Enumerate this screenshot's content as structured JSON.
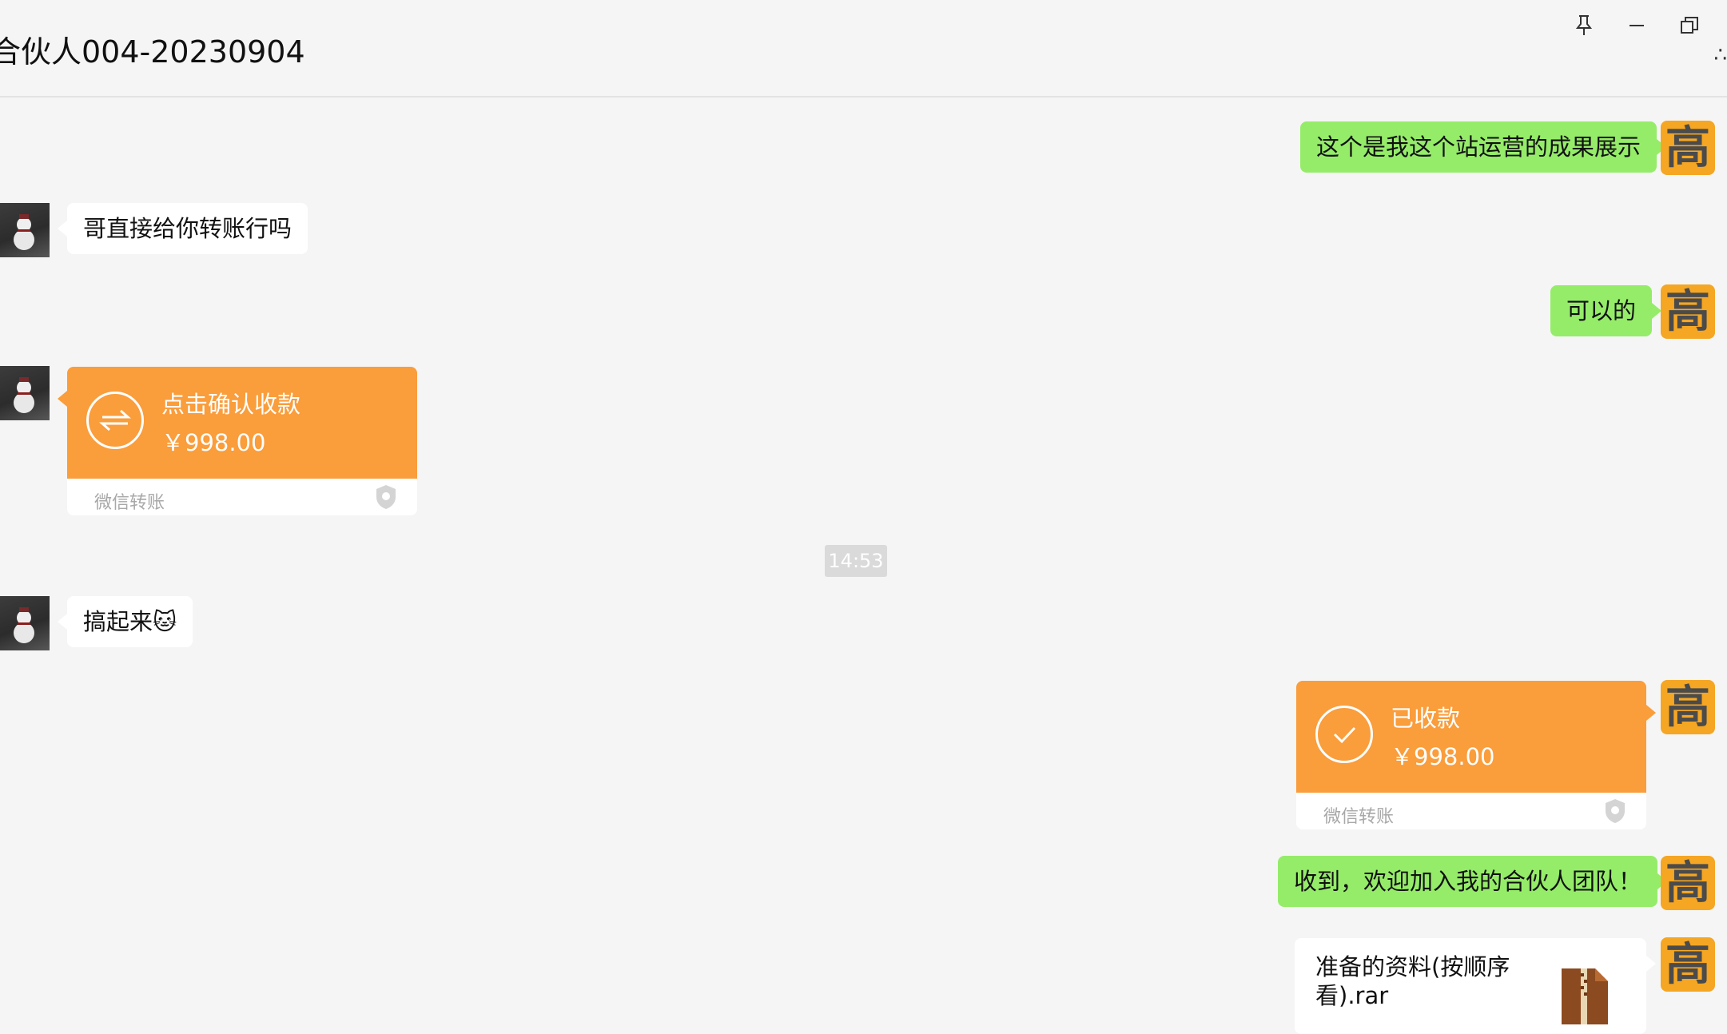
{
  "header": {
    "title": "合伙人004-20230904",
    "edge_char": "∴",
    "buttons": [
      {
        "name": "pin",
        "icon": "pin-icon"
      },
      {
        "name": "minimize",
        "icon": "minimize-icon"
      },
      {
        "name": "restore",
        "icon": "restore-icon"
      }
    ]
  },
  "self_avatar_char": "高",
  "messages": [
    {
      "side": "right",
      "type": "text",
      "text": "这个是我这个站运营的成果展示"
    },
    {
      "side": "left",
      "type": "text",
      "text": "哥直接给你转账行吗"
    },
    {
      "side": "right",
      "type": "text",
      "text": "可以的"
    },
    {
      "side": "left",
      "type": "transfer",
      "status": "点击确认收款",
      "amount": "￥998.00",
      "label": "微信转账"
    },
    {
      "side": "left",
      "type": "text",
      "text": "搞起来🐱"
    },
    {
      "side": "right",
      "type": "transfer",
      "status": "已收款",
      "amount": "￥998.00",
      "label": "微信转账"
    },
    {
      "side": "right",
      "type": "text",
      "text": "收到，欢迎加入我的合伙人团队！"
    },
    {
      "side": "right",
      "type": "file",
      "file_name": "准备的资料(按顺序看).rar"
    }
  ],
  "timestamp": "14:53",
  "colors": {
    "self_bubble": "#95ec69",
    "other_bubble": "#ffffff",
    "transfer": "#fa9d3b",
    "avatar_bg": "#f5a623"
  }
}
